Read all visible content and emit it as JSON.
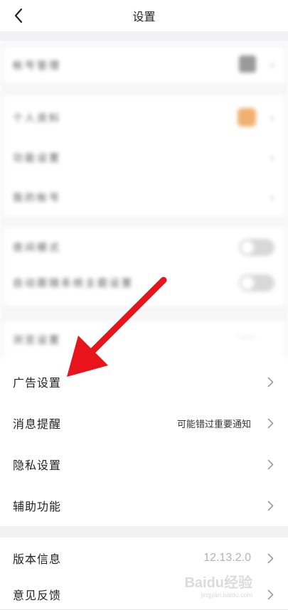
{
  "header": {
    "title": "设置"
  },
  "blurred_section": {
    "rows": [
      {
        "label": "帐号管理"
      },
      {
        "label": "个人资料"
      },
      {
        "label": "功能设置"
      },
      {
        "label": "我的帐号"
      },
      {
        "label": "夜间模式"
      },
      {
        "label": "自动跟随系统主题设置"
      },
      {
        "label": "浏览设置"
      }
    ]
  },
  "settings": {
    "ad_settings": {
      "label": "广告设置"
    },
    "notifications": {
      "label": "消息提醒",
      "value": "可能错过重要通知"
    },
    "privacy": {
      "label": "隐私设置"
    },
    "accessibility": {
      "label": "辅助功能"
    },
    "version": {
      "label": "版本信息",
      "value": "12.13.2.0"
    },
    "feedback": {
      "label": "意见反馈"
    }
  },
  "annotation": {
    "color": "#e8141c",
    "icon": "red-arrow-icon"
  },
  "watermark": {
    "text": "Bai",
    "text2": "du",
    "text3": "经验",
    "sub": "jingyan.baidu.com"
  }
}
